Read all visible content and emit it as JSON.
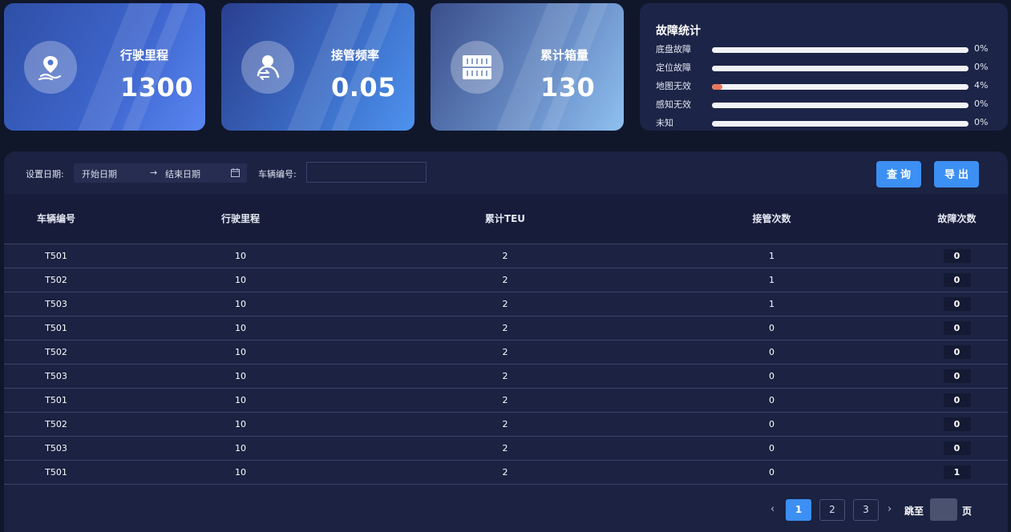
{
  "stats": [
    {
      "label": "行驶里程",
      "value": "1300",
      "icon": "location-route-icon"
    },
    {
      "label": "接管频率",
      "value": "0.05",
      "icon": "user-swap-icon"
    },
    {
      "label": "累计箱量",
      "value": "130",
      "icon": "container-icon"
    }
  ],
  "faults": {
    "title": "故障统计",
    "items": [
      {
        "name": "底盘故障",
        "percent": 0,
        "text": "0%"
      },
      {
        "name": "定位故障",
        "percent": 0,
        "text": "0%"
      },
      {
        "name": "地图无效",
        "percent": 4,
        "text": "4%"
      },
      {
        "name": "感知无效",
        "percent": 0,
        "text": "0%"
      },
      {
        "name": "未知",
        "percent": 0,
        "text": "0%"
      }
    ],
    "bar_color": "#e9775a"
  },
  "filters": {
    "date_label": "设置日期:",
    "start_placeholder": "开始日期",
    "arrow": "→",
    "end_placeholder": "结束日期",
    "vehicle_label": "车辆编号:",
    "vehicle_value": "",
    "query_button": "查询",
    "export_button": "导出"
  },
  "table": {
    "columns": [
      "车辆编号",
      "行驶里程",
      "累计TEU",
      "接管次数",
      "故障次数"
    ],
    "rows": [
      [
        "T501",
        "10",
        "2",
        "1",
        "0"
      ],
      [
        "T502",
        "10",
        "2",
        "1",
        "0"
      ],
      [
        "T503",
        "10",
        "2",
        "1",
        "0"
      ],
      [
        "T501",
        "10",
        "2",
        "0",
        "0"
      ],
      [
        "T502",
        "10",
        "2",
        "0",
        "0"
      ],
      [
        "T503",
        "10",
        "2",
        "0",
        "0"
      ],
      [
        "T501",
        "10",
        "2",
        "0",
        "0"
      ],
      [
        "T502",
        "10",
        "2",
        "0",
        "0"
      ],
      [
        "T503",
        "10",
        "2",
        "0",
        "0"
      ],
      [
        "T501",
        "10",
        "2",
        "0",
        "1"
      ]
    ]
  },
  "pagination": {
    "prev": "‹",
    "next": "›",
    "pages": [
      "1",
      "2",
      "3"
    ],
    "current": "1",
    "jump_label": "跳至",
    "page_suffix": "页"
  },
  "colors": {
    "accent": "#3c8ff3",
    "background": "#10172b",
    "panel": "#1b2242"
  }
}
